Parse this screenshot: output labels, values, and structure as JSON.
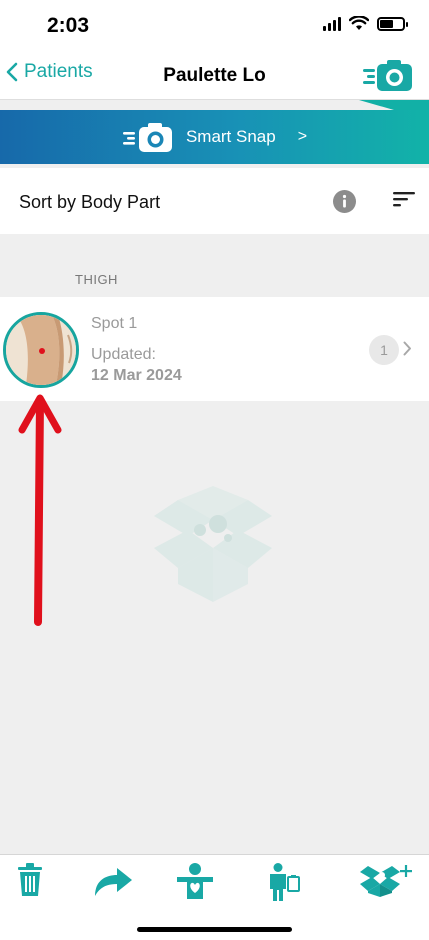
{
  "status_bar": {
    "time": "2:03"
  },
  "nav": {
    "back_label": "Patients",
    "title": "Paulette Lo"
  },
  "banner": {
    "label": "Smart Snap",
    "arrow": ">"
  },
  "sort": {
    "label": "Sort by Body Part"
  },
  "section": {
    "header": "THIGH"
  },
  "spot": {
    "name": "Spot 1",
    "updated_label": "Updated:",
    "updated_date": "12 Mar 2024",
    "count": "1"
  },
  "colors": {
    "accent": "#19a8a5",
    "banner_start": "#1769aa",
    "banner_end": "#12b3a8",
    "annotation": "#e0101c"
  },
  "toolbar": {
    "icons": [
      "trash-icon",
      "share-arrow-icon",
      "patient-heart-icon",
      "body-map-icon",
      "add-box-icon"
    ]
  }
}
